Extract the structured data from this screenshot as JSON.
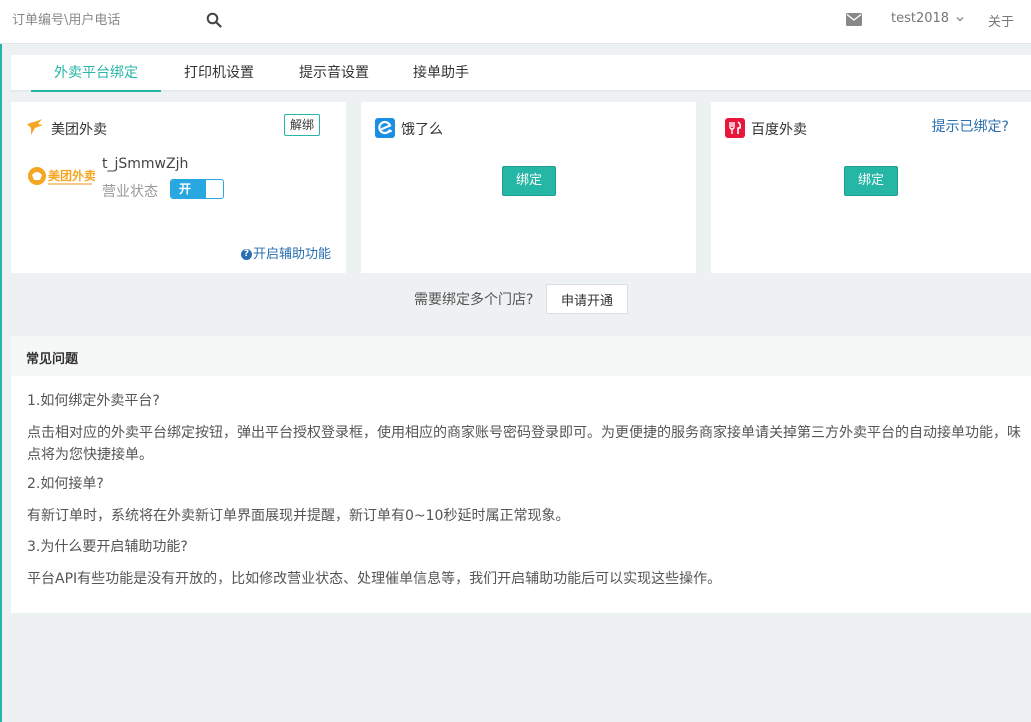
{
  "search": {
    "placeholder": "订单编号\\用户电话"
  },
  "header": {
    "username": "test2018",
    "about": "关于"
  },
  "tabs": [
    {
      "label": "外卖平台绑定",
      "active": true
    },
    {
      "label": "打印机设置",
      "active": false
    },
    {
      "label": "提示音设置",
      "active": false
    },
    {
      "label": "接单助手",
      "active": false
    }
  ],
  "cards": {
    "meituan": {
      "title": "美团外卖",
      "unbind": "解绑",
      "logo_text": "美团外卖",
      "account": "t_jSmmwZjh",
      "status_label": "营业状态",
      "toggle_label": "开",
      "toggle_on": true,
      "assist_link": "开启辅助功能"
    },
    "eleme": {
      "title": "饿了么",
      "bind": "绑定"
    },
    "baidu": {
      "title": "百度外卖",
      "bind": "绑定",
      "hint": "提示已绑定?"
    }
  },
  "multi_store": {
    "text": "需要绑定多个门店?",
    "button": "申请开通"
  },
  "faq": {
    "title": "常见问题",
    "items": [
      {
        "q": "1.如何绑定外卖平台?",
        "a": "点击相对应的外卖平台绑定按钮，弹出平台授权登录框，使用相应的商家账号密码登录即可。为更便捷的服务商家接单请关掉第三方外卖平台的自动接单功能，味点将为您快捷接单。"
      },
      {
        "q": "2.如何接单?",
        "a": "有新订单时，系统将在外卖新订单界面展现并提醒，新订单有0~10秒延时属正常现象。"
      },
      {
        "q": "3.为什么要开启辅助功能?",
        "a": "平台API有些功能是没有开放的，比如修改营业状态、处理催单信息等，我们开启辅助功能后可以实现这些操作。"
      }
    ]
  },
  "colors": {
    "accent": "#26b6a6",
    "link": "#2a6fb0",
    "toggle": "#29a7e1",
    "meituan": "#f5a623",
    "eleme": "#1a8fe3",
    "baidu": "#e8173c"
  },
  "icons": {
    "search": "search-icon",
    "mail": "mail-icon",
    "chevron": "chevron-down-icon",
    "meituan": "meituan-logo-icon",
    "eleme": "eleme-logo-icon",
    "baidu": "baidu-logo-icon",
    "question": "question-circle-icon"
  }
}
